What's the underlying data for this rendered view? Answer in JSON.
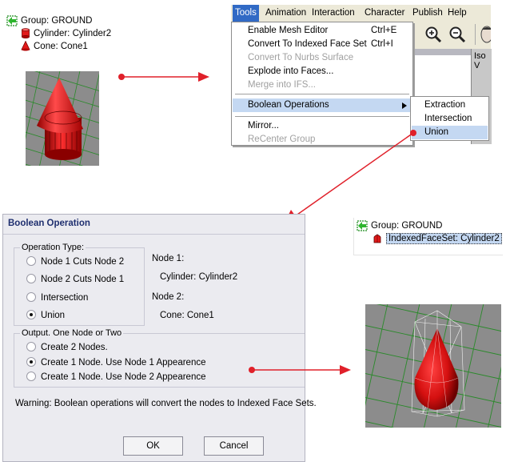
{
  "left_tree": {
    "items": [
      {
        "label": "Group:  GROUND"
      },
      {
        "label": "Cylinder:  Cylinder2"
      },
      {
        "label": "Cone:  Cone1"
      }
    ]
  },
  "menu": {
    "bar": [
      "Tools",
      "Animation",
      "Interaction",
      "Character",
      "Publish",
      "Help"
    ],
    "partial_label": "Iso V",
    "dropdown": [
      {
        "label": "Enable Mesh Editor",
        "shortcut": "Ctrl+E"
      },
      {
        "label": "Convert To Indexed Face Set",
        "shortcut": "Ctrl+I"
      },
      {
        "label": "Convert To Nurbs Surface",
        "shortcut": ""
      },
      {
        "label": "Explode into Faces...",
        "shortcut": ""
      },
      {
        "label": "Merge into IFS...",
        "shortcut": ""
      },
      {
        "label": "Boolean Operations",
        "shortcut": ""
      },
      {
        "label": "Mirror...",
        "shortcut": ""
      },
      {
        "label": "ReCenter Group",
        "shortcut": ""
      }
    ],
    "submenu": [
      "Extraction",
      "Intersection",
      "Union"
    ]
  },
  "dialog": {
    "title": "Boolean Operation",
    "operation_type": {
      "label": "Operation Type:",
      "options": [
        "Node 1 Cuts Node 2",
        "Node 2 Cuts Node 1",
        "Intersection",
        "Union"
      ],
      "selected": "Union"
    },
    "node1": {
      "label": "Node 1:",
      "value": "Cylinder:  Cylinder2"
    },
    "node2": {
      "label": "Node 2:",
      "value": "Cone:  Cone1"
    },
    "output": {
      "label": "Output.  One Node or Two",
      "options": [
        "Create 2 Nodes.",
        "Create 1 Node.  Use Node 1 Appearence",
        "Create 1 Node.  Use Node 2 Appearence"
      ],
      "selected": "Create 1 Node.  Use Node 1 Appearence"
    },
    "warning": "Warning:  Boolean operations will convert the nodes to Indexed Face Sets.",
    "ok_label": "OK",
    "cancel_label": "Cancel"
  },
  "right_tree": {
    "items": [
      {
        "label": "Group:  GROUND"
      },
      {
        "label": "IndexedFaceSet:  Cylinder2"
      }
    ]
  },
  "colors": {
    "arrow_red": "#e0202a",
    "menu_highlight": "#316ac5",
    "item_highlight": "#c4d8f2",
    "object_red": "#d81818",
    "grid_green": "#2a8a2a"
  }
}
